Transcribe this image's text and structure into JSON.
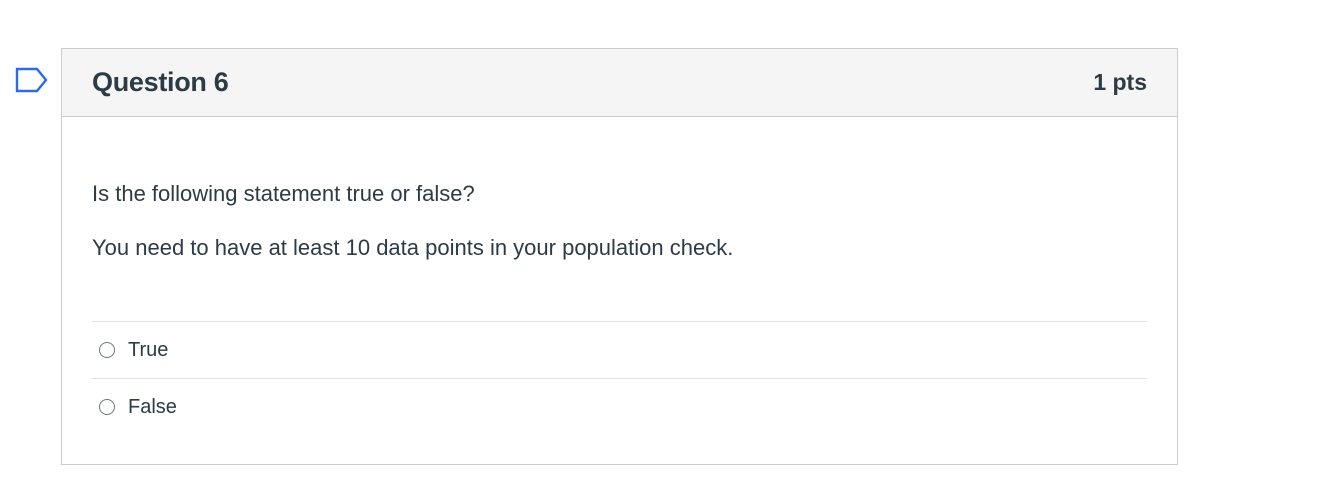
{
  "question": {
    "title": "Question 6",
    "points": "1 pts",
    "prompt": "Is the following statement true or false?",
    "statement": "You need to have at least 10 data points in your population check.",
    "answers": [
      {
        "label": "True"
      },
      {
        "label": "False"
      }
    ]
  },
  "icons": {
    "flag": "flag-outline-icon",
    "radio": "radio-unchecked-icon"
  },
  "colors": {
    "text": "#2d3b45",
    "header_bg": "#f5f5f5",
    "border": "#c7cdd1",
    "flag": "#2d6be4"
  }
}
